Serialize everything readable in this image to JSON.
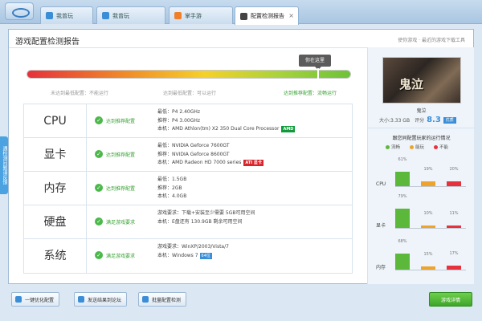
{
  "tabs": [
    {
      "label": "我曾玩",
      "color": "#3a8ed8",
      "active": false
    },
    {
      "label": "我曾玩",
      "color": "#3a8ed8",
      "active": false
    },
    {
      "label": "掌手游",
      "color": "#f07f2a",
      "active": false
    },
    {
      "label": "配置检测报告",
      "color": "#444444",
      "active": true
    }
  ],
  "report": {
    "title": "游戏配置检测报告",
    "top_right": "使你游戏 · 最近的游戏下载工具",
    "meter_knob": "你在这里",
    "meter_level_percent": 90,
    "meter_labels": [
      "未达到最低配置：不能运行",
      "达到最低配置：可以运行",
      "达到推荐配置：流畅运行"
    ]
  },
  "hardware": [
    {
      "name": "CPU",
      "status": "达到推荐配置",
      "specs": [
        "最低：P4 2.40GHz",
        "推荐：P4 3.00GHz",
        "本机：AMD Athlon(tm) X2 350 Dual Core Processor"
      ],
      "badge": "AMD",
      "badge_type": "amd"
    },
    {
      "name": "显卡",
      "status": "达到推荐配置",
      "specs": [
        "最低：NVIDIA Geforce 7600GT",
        "推荐：NVIDIA Geforce 8600GT",
        "本机：AMD Radeon HD 7000 series"
      ],
      "badge": "ATI 显卡",
      "badge_type": "ati"
    },
    {
      "name": "内存",
      "status": "达到推荐配置",
      "specs": [
        "最低：1.5GB",
        "推荐：2GB",
        "本机：4.0GB"
      ],
      "badge": "",
      "badge_type": ""
    },
    {
      "name": "硬盘",
      "status": "满足游戏要求",
      "specs": [
        "游戏要求：下载+安装至少需要 5GB可用空间",
        "本机：E盘还有 130.9GB 剩余可用空间"
      ],
      "badge": "",
      "badge_type": ""
    },
    {
      "name": "系统",
      "status": "满足游戏要求",
      "specs": [
        "游戏要求：WinXP/2003/Vista/7",
        "本机：Windows 7"
      ],
      "badge": "64位",
      "badge_type": "w7"
    }
  ],
  "game": {
    "image_title": "鬼泣",
    "name": "鬼泣",
    "size": "大小:3.33 GB",
    "rating_label": "评分",
    "score": "8.3",
    "score_badge": "优质"
  },
  "side": {
    "title": "跟您同配置玩家的运行情况",
    "legend": [
      {
        "label": "流畅",
        "color": "#5cb83a"
      },
      {
        "label": "能玩",
        "color": "#f0a32a"
      },
      {
        "label": "不能",
        "color": "#e5323c"
      }
    ],
    "rows": [
      {
        "label": "CPU",
        "values": [
          61,
          19,
          20
        ]
      },
      {
        "label": "显卡",
        "values": [
          79,
          10,
          11
        ]
      },
      {
        "label": "内存",
        "values": [
          68,
          15,
          17
        ]
      }
    ],
    "row_pct_labels": [
      [
        "61%",
        "19%",
        "20%"
      ],
      [
        "79%",
        "10%",
        "11%"
      ],
      [
        "68%",
        "15%",
        "17%"
      ]
    ]
  },
  "float_tab": "遇检测问题请反馈",
  "bottom_buttons": [
    "一键优化配置",
    "发送结果到论坛",
    "批量配置检测"
  ],
  "bottom_green": "游戏详情"
}
